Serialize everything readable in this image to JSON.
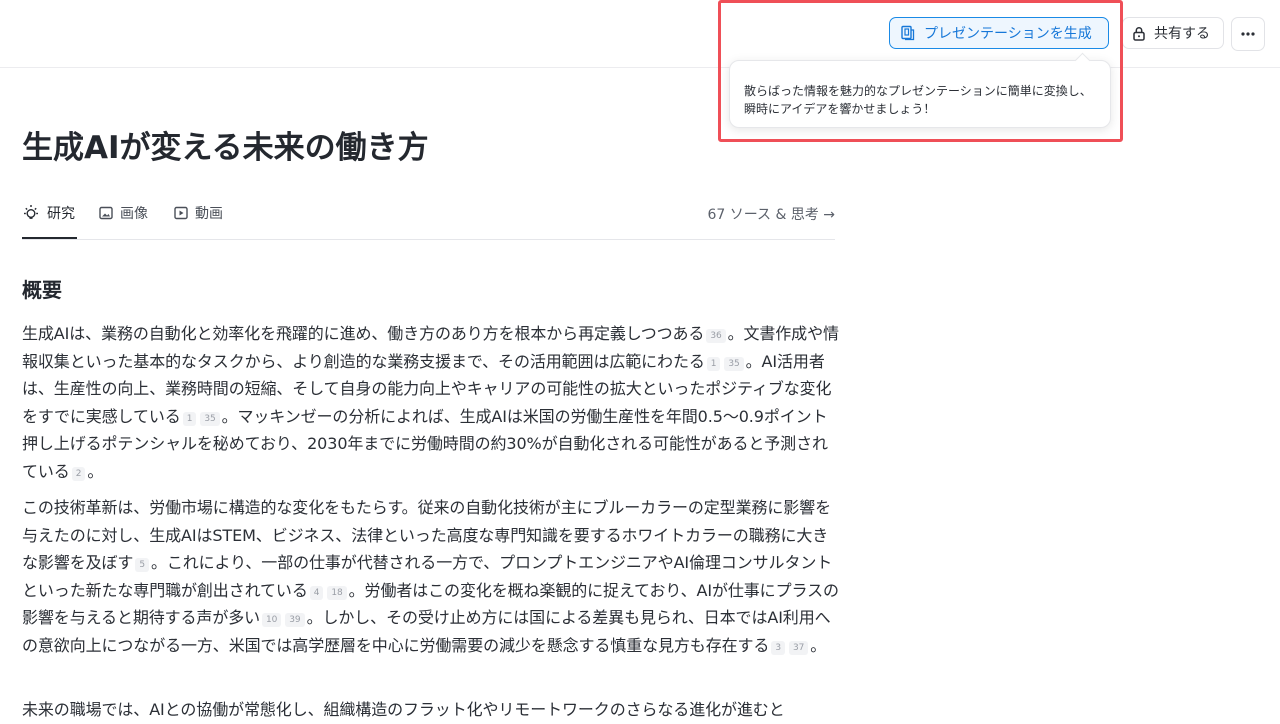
{
  "header": {
    "present_button": "プレゼンテーションを生成",
    "share_button": "共有する",
    "tooltip": "散らばった情報を魅力的なプレゼンテーションに簡単に変換し、瞬時にアイデアを響かせましょう！"
  },
  "title": "生成AIが変える未来の働き方",
  "tabs": [
    {
      "label": "研究",
      "icon": "lightbulb-icon"
    },
    {
      "label": "画像",
      "icon": "image-icon"
    },
    {
      "label": "動画",
      "icon": "video-icon"
    }
  ],
  "sources_link": "67 ソース & 思考 →",
  "section_heading": "概要",
  "paragraphs": {
    "p1": {
      "t1": "生成AIは、業務の自動化と効率化を飛躍的に進め、働き方のあり方を根本から再定義しつつある",
      "c1": "36",
      "t2": "。文書作成や情報収集といった基本的なタスクから、より創造的な業務支援まで、その活用範囲は広範にわたる",
      "c2": "1",
      "c3": "35",
      "t3": "。AI活用者は、生産性の向上、業務時間の短縮、そして自身の能力向上やキャリアの可能性の拡大といったポジティブな変化をすでに実感している",
      "c4": "1",
      "c5": "35",
      "t4": "。マッキンゼーの分析によれば、生成AIは米国の労働生産性を年間0.5〜0.9ポイント押し上げるポテンシャルを秘めており、2030年までに労働時間の約30%が自動化される可能性があると予測されている",
      "c6": "2",
      "t5": "。"
    },
    "p2": {
      "t1": "この技術革新は、労働市場に構造的な変化をもたらす。従来の自動化技術が主にブルーカラーの定型業務に影響を与えたのに対し、生成AIはSTEM、ビジネス、法律といった高度な専門知識を要するホワイトカラーの職務に大きな影響を及ぼす",
      "c1": "5",
      "t2": "。これにより、一部の仕事が代替される一方で、プロンプトエンジニアやAI倫理コンサルタントといった新たな専門職が創出されている",
      "c2": "4",
      "c3": "18",
      "t3": "。労働者はこの変化を概ね楽観的に捉えており、AIが仕事にプラスの影響を与えると期待する声が多い",
      "c4": "10",
      "c5": "39",
      "t4": "。しかし、その受け止め方には国による差異も見られ、日本ではAI利用への意欲向上につながる一方、米国では高学歴層を中心に労働需要の減少を懸念する慎重な見方も存在する",
      "c6": "3",
      "c7": "37",
      "t5": "。"
    },
    "p3": {
      "t1": "未来の職場では、AIとの協働が常態化し、組織構造のフラット化やリモートワークのさらなる進化が進むと"
    }
  }
}
